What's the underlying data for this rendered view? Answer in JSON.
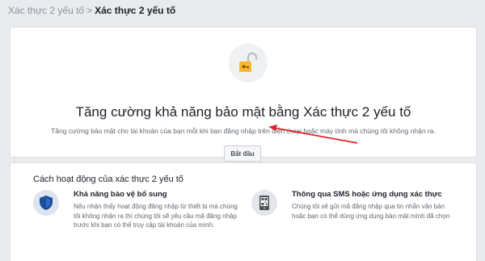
{
  "breadcrumb": {
    "parent": "Xác thực 2 yếu tố",
    "separator": ">",
    "current": "Xác thực 2 yếu tố"
  },
  "hero": {
    "icon": "lock-icon",
    "title": "Tăng cường khả năng bảo mật bằng Xác thực 2 yếu tố",
    "description": "Tăng cường bảo mật cho tài khoản của bạn mỗi khi bạn đăng nhập trên điện thoại hoặc máy tính mà chúng tôi không nhận ra.",
    "start_label": "Bắt đầu"
  },
  "how": {
    "title": "Cách hoạt động của xác thực 2 yếu tố",
    "features": [
      {
        "icon": "shield-icon",
        "title": "Khả năng bảo vệ bổ sung",
        "text": "Nếu nhận thấy hoạt động đăng nhập từ thiết bị mà chúng tôi không nhận ra thì chúng tôi sẽ yêu cầu mã đăng nhập trước khi bạn có thể truy cập tài khoản của mình."
      },
      {
        "icon": "phone-qr-icon",
        "title": "Thông qua SMS hoặc ứng dụng xác thực",
        "text": "Chúng tôi sẽ gửi mã đăng nhập qua tin nhắn văn bản hoặc bạn có thể dùng ứng dụng bảo mật mình đã chọn"
      }
    ]
  },
  "colors": {
    "background": "#e9ebee",
    "annotation_arrow": "#e0242c",
    "shield": "#1c4f9c"
  }
}
